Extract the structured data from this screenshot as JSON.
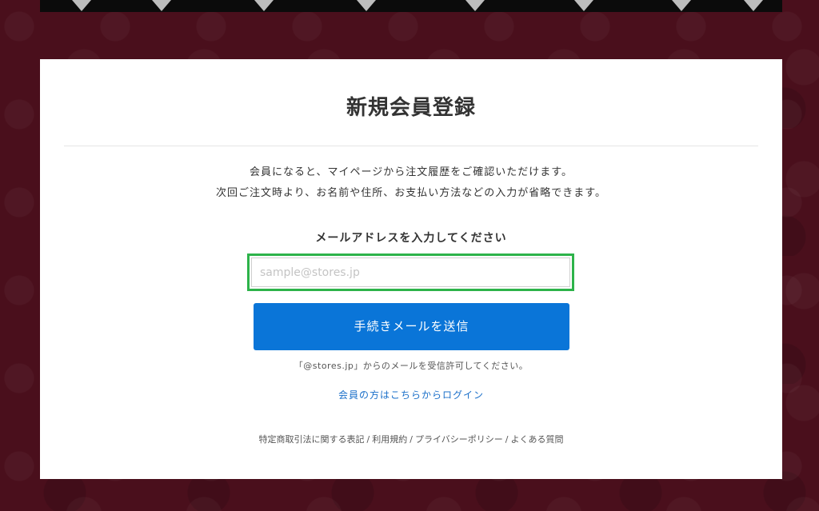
{
  "signup": {
    "title": "新規会員登録",
    "intro_line1": "会員になると、マイページから注文履歴をご確認いただけます。",
    "intro_line2": "次回ご注文時より、お名前や住所、お支払い方法などの入力が省略できます。",
    "email_label": "メールアドレスを入力してください",
    "email_value": "",
    "email_placeholder": "sample@stores.jp",
    "submit_label": "手続きメールを送信",
    "notice": "「@stores.jp」からのメールを受信許可してください。",
    "login_link": "会員の方はこちらからログイン"
  },
  "footer": {
    "links": [
      "特定商取引法に関する表記",
      "利用規約",
      "プライバシーポリシー",
      "よくある質問"
    ],
    "separator": "/"
  },
  "colors": {
    "background": "#4a0f1c",
    "card": "#ffffff",
    "primary_button": "#0a75d8",
    "link": "#1a6fc9",
    "focus_outline": "#2db34a"
  }
}
